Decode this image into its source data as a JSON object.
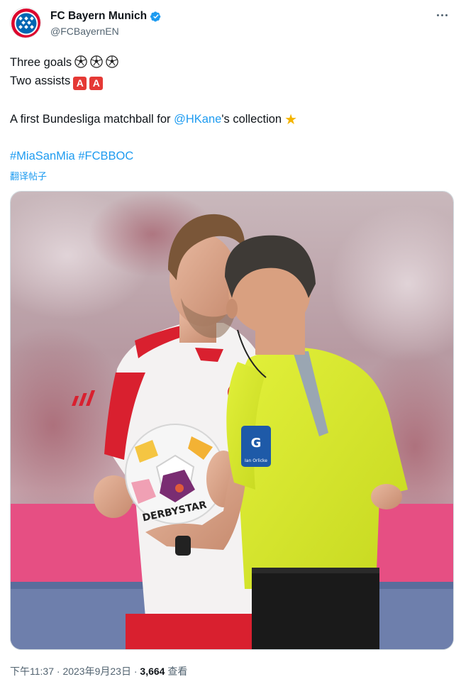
{
  "account": {
    "display_name": "FC Bayern Munich",
    "handle": "@FCBayernEN",
    "avatar_icon": "fc-bayern-logo",
    "verified": true,
    "verified_color": "#1d9bf0"
  },
  "tweet": {
    "line1_text": "Three goals",
    "line1_emoji": "soccer-ball x3",
    "line2_text": "Two assists",
    "line2_emoji_letter": "A",
    "line3_prefix": "A first Bundesliga matchball for ",
    "line3_mention": "@HKane",
    "line3_suffix": "'s collection",
    "line3_emoji": "star",
    "hashtag1": "#MiaSanMia",
    "hashtag2": "#FCBBOC",
    "translate_label": "翻译帖子"
  },
  "photo": {
    "ball_text": "DERBYSTAR",
    "badge_text": "Ian Orlicke"
  },
  "footer": {
    "time": "下午11:37",
    "separator": " · ",
    "date": "2023年9月23日",
    "views_count": "3,664",
    "views_label": " 查看"
  },
  "colors": {
    "link": "#1d9bf0",
    "secondary_text": "#536471",
    "assist_badge": "#e53935",
    "referee_shirt": "#d8ea28",
    "bayern_red": "#dc052d"
  }
}
